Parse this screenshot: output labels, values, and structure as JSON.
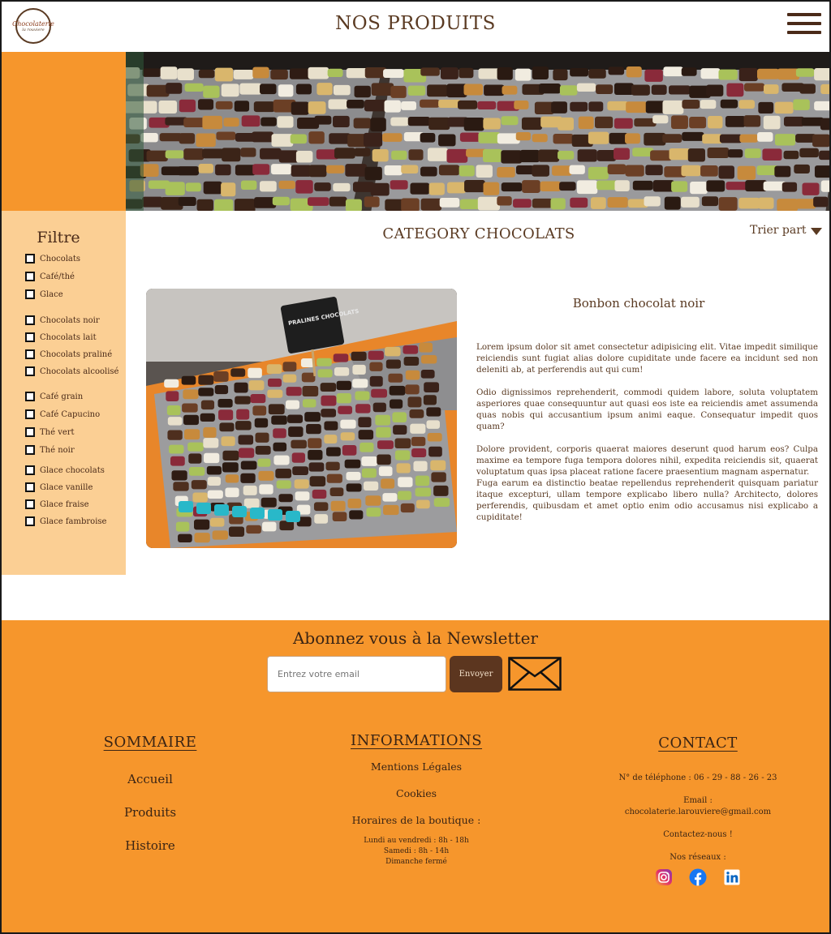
{
  "header": {
    "logo_line1": "Chocolaterie",
    "logo_line2": "la rouviere",
    "title": "NOS PRODUITS",
    "menu_icon": "hamburger-menu-icon"
  },
  "sidebar": {
    "title": "Filtre",
    "options": [
      "Chocolats",
      "Café/thé",
      "Glace",
      "Chocolats noir",
      "Chocolats lait",
      "Chocolats praliné",
      "Chocolats alcoolisé",
      "Café grain",
      "Café Capucino",
      "Thé vert",
      "Thé noir",
      "Glace chocolats",
      "Glace vanille",
      "Glace fraise",
      "Glace fambroise"
    ]
  },
  "main": {
    "category_title": "CATEGORY CHOCOLATS",
    "sort_label": "Trier part",
    "product": {
      "name": "Bonbon chocolat noir",
      "image_sign": "PRALINES CHOCOLATS",
      "paragraphs": [
        "Lorem ipsum dolor sit amet consectetur adipisicing elit. Vitae impedit similique reiciendis sunt fugiat alias dolore cupiditate unde facere ea incidunt sed non deleniti ab, at perferendis aut qui cum!",
        "Odio dignissimos reprehenderit, commodi quidem labore, soluta voluptatem asperiores quae consequuntur aut quasi eos iste ea reiciendis amet assumenda quas nobis qui accusantium ipsum animi eaque. Consequatur impedit quos quam?",
        "Dolore provident, corporis quaerat maiores deserunt quod harum eos? Culpa maxime ea tempore fuga tempora dolores nihil, expedita reiciendis sit, quaerat voluptatum quas ipsa placeat ratione facere praesentium magnam aspernatur.",
        "Fuga earum ea distinctio beatae repellendus reprehenderit quisquam pariatur itaque excepturi, ullam tempore explicabo libero nulla? Architecto, dolores perferendis, quibusdam et amet optio enim odio accusamus nisi explicabo a cupiditate!"
      ]
    }
  },
  "newsletter": {
    "title": "Abonnez vous à la Newsletter",
    "placeholder": "Entrez votre email",
    "button": "Envoyer",
    "icon": "envelope-icon"
  },
  "footer": {
    "sommaire": {
      "title": "SOMMAIRE",
      "links": [
        "Accueil",
        "Produits",
        "Histoire"
      ]
    },
    "informations": {
      "title": "INFORMATIONS",
      "links": [
        "Mentions Légales",
        "Cookies"
      ],
      "hours_title": "Horaires de la boutique :",
      "hours": [
        "Lundi au vendredi : 8h - 18h",
        "Samedi : 8h - 14h",
        "Dimanche fermé"
      ]
    },
    "contact": {
      "title": "CONTACT",
      "phone": "N° de téléphone : 06 - 29 - 88 - 26 - 23",
      "email_label": "Email :",
      "email": "chocolaterie.larouviere@gmail.com",
      "contact_link": "Contactez-nous !",
      "networks_label": "Nos réseaux :",
      "networks": [
        "instagram-icon",
        "facebook-icon",
        "linkedin-icon"
      ]
    }
  },
  "colors": {
    "orange": "#f6962c",
    "light_orange": "#fbcf94",
    "brown": "#5c361f",
    "text_brown": "#5a3a22"
  }
}
